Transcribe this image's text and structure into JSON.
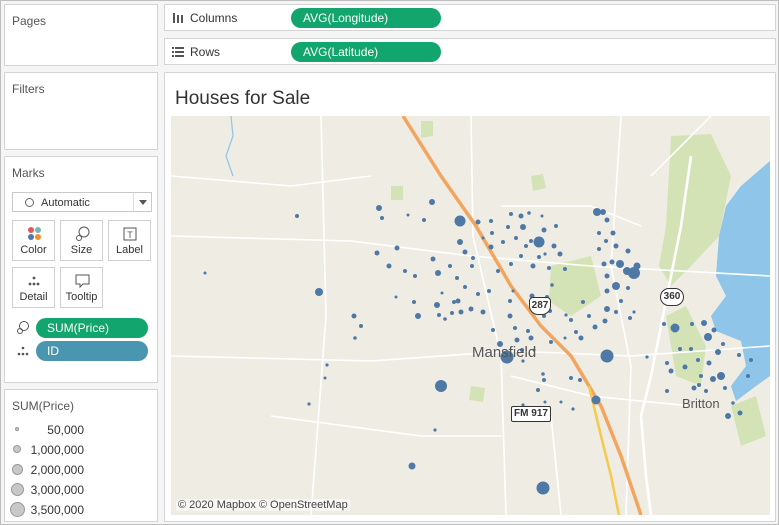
{
  "cards": {
    "pages_title": "Pages",
    "filters_title": "Filters",
    "marks_title": "Marks"
  },
  "marks": {
    "mark_type": "Automatic",
    "buttons": [
      "Color",
      "Size",
      "Label",
      "Detail",
      "Tooltip"
    ],
    "pills": [
      {
        "field": "SUM(Price)",
        "encoding": "size",
        "icon": "size-icon",
        "color": "#12a56d"
      },
      {
        "field": "ID",
        "encoding": "detail",
        "icon": "detail-icon",
        "color": "#4a96b0"
      }
    ]
  },
  "legend": {
    "title": "SUM(Price)",
    "items": [
      "50,000",
      "1,000,000",
      "2,000,000",
      "3,000,000",
      "3,500,000"
    ]
  },
  "shelves": {
    "columns_label": "Columns",
    "columns_pill": "AVG(Longitude)",
    "rows_label": "Rows",
    "rows_pill": "AVG(Latitude)"
  },
  "view": {
    "title": "Houses for Sale",
    "attribution": "© 2020 Mapbox © OpenStreetMap"
  },
  "map": {
    "labels": {
      "city": "Mansfield",
      "town": "Britton",
      "road_287": "287",
      "road_360": "360",
      "road_fm917": "FM 917"
    },
    "point_color": "#4e79a7",
    "land_color": "#efece4",
    "water_color": "#8ec5e8",
    "park_color": "#cfe0b0",
    "highway_color": "#f2a55e"
  }
}
